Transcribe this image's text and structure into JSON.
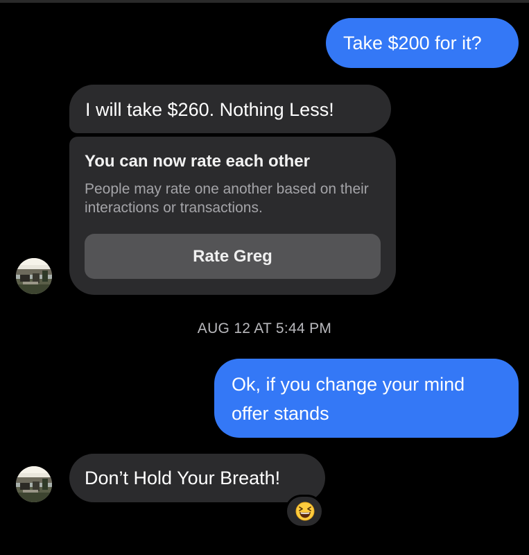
{
  "conversation": {
    "contact_name": "Greg",
    "messages": [
      {
        "direction": "sent",
        "text": "Take $200 for it?"
      },
      {
        "direction": "received",
        "text": "I will take $260.  Nothing Less!"
      }
    ],
    "rating_card": {
      "title": "You can now rate each other",
      "description": "People may rate one another based on their interactions or transactions.",
      "button_label": "Rate Greg"
    },
    "timestamp": "AUG 12 AT 5:44 PM",
    "later_messages": [
      {
        "direction": "sent",
        "lines": [
          "Ok, if you change your mind",
          "offer stands"
        ]
      },
      {
        "direction": "received",
        "text": "Don’t Hold Your Breath!",
        "reaction": "grinning-squinting-face-emoji"
      }
    ]
  },
  "colors": {
    "background": "#000000",
    "sent_bubble": "#3478f6",
    "received_bubble": "#2b2b2d",
    "rate_button": "#545456",
    "secondary_text": "#a4a4a8"
  }
}
